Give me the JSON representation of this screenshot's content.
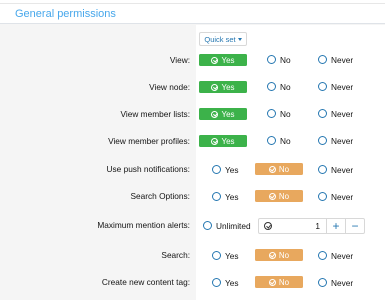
{
  "header": {
    "title": "General permissions"
  },
  "quick_set": {
    "label": "Quick set"
  },
  "options": {
    "yes": "Yes",
    "no": "No",
    "never": "Never",
    "unlimited": "Unlimited"
  },
  "colors": {
    "yes": "#3cb24a",
    "no": "#e8a85e",
    "link": "#2577b1",
    "title": "#47a7eb"
  },
  "rows": [
    {
      "label": "View:",
      "value": "Yes"
    },
    {
      "label": "View node:",
      "value": "Yes"
    },
    {
      "label": "View member lists:",
      "value": "Yes"
    },
    {
      "label": "View member profiles:",
      "value": "Yes"
    },
    {
      "label": "Use push notifications:",
      "value": "No"
    },
    {
      "label": "Search Options:",
      "value": "No"
    },
    {
      "label": "Maximum mention alerts:",
      "value": "1"
    },
    {
      "label": "Search:",
      "value": "No"
    },
    {
      "label": "Create new content tag:",
      "value": "No"
    }
  ],
  "mention_stepper": {
    "value": "1",
    "plus": "+",
    "minus": "−"
  }
}
